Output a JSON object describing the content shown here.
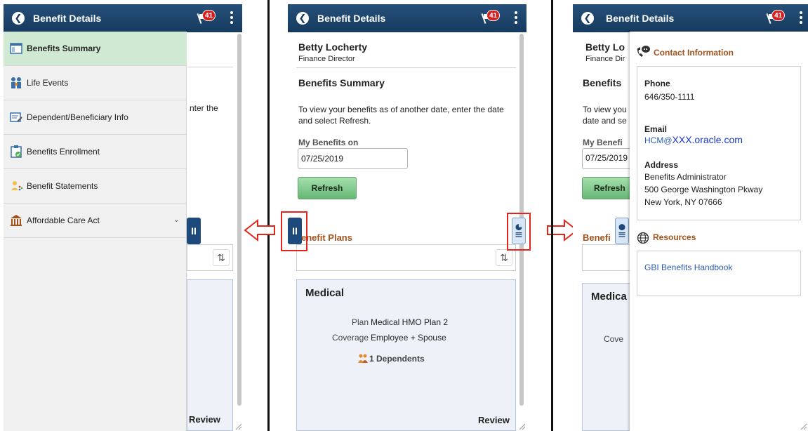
{
  "header": {
    "title": "Benefit Details",
    "back_icon": "back-arrow-icon",
    "notification_count": "41",
    "flag_icon": "notification-flag-icon",
    "actions_icon": "kebab-menu-icon",
    "color": "#1d4a7a"
  },
  "menu": {
    "items": [
      {
        "label": "Benefits Summary",
        "icon": "summary-icon",
        "selected": true
      },
      {
        "label": "Life Events",
        "icon": "life-events-icon"
      },
      {
        "label": "Dependent/Beneficiary Info",
        "icon": "dependent-icon"
      },
      {
        "label": "Benefits Enrollment",
        "icon": "enrollment-icon"
      },
      {
        "label": "Benefit Statements",
        "icon": "statements-icon"
      },
      {
        "label": "Affordable Care Act",
        "icon": "aca-building-icon",
        "expandable": true
      }
    ],
    "selected_color": "#cfe9d3"
  },
  "employee": {
    "name": "Betty Locherty",
    "title": "Finance Director"
  },
  "summary": {
    "title": "Benefits Summary",
    "instructions": "To view your benefits as of another date, enter the date and select Refresh.",
    "instructions_partial_1": "nter the",
    "date_label": "My Benefits on",
    "date_value": "07/25/2019",
    "refresh_label": "Refresh"
  },
  "plans": {
    "title": "Benefit Plans",
    "title_partial": "enefit Plans",
    "medical": {
      "title": "Medical",
      "plan_label": "Plan",
      "plan_value": "Medical HMO Plan 2",
      "coverage_label": "Coverage",
      "coverage_value": "Employee + Spouse",
      "dependents": "1 Dependents"
    },
    "review_label": "Review"
  },
  "contact": {
    "title": "Contact Information",
    "phone_label": "Phone",
    "phone_value": "646/350-1111",
    "email_label": "Email",
    "email_user": "HCM@",
    "email_domain": "XXX.oracle.com",
    "address_label": "Address",
    "address_lines": [
      "Benefits Administrator",
      "500 George Washington Pkway",
      "New York, NY 07666"
    ]
  },
  "resources": {
    "title": "Resources",
    "link": "GBI Benefits Handbook"
  },
  "partials": {
    "name_3": "Betty Lo",
    "role_3": "Finance Dir",
    "summary_3": "Benefits",
    "instr_3a": "To view you",
    "instr_3b": "date and se",
    "date_label_3": "My Benefi",
    "date_3": "07/25/2019",
    "refresh_3": "Refresh",
    "plans_3": "Benefi",
    "medical_3": "Medica",
    "coverage_3": "Cove"
  },
  "annotation_color": "#e2241b"
}
